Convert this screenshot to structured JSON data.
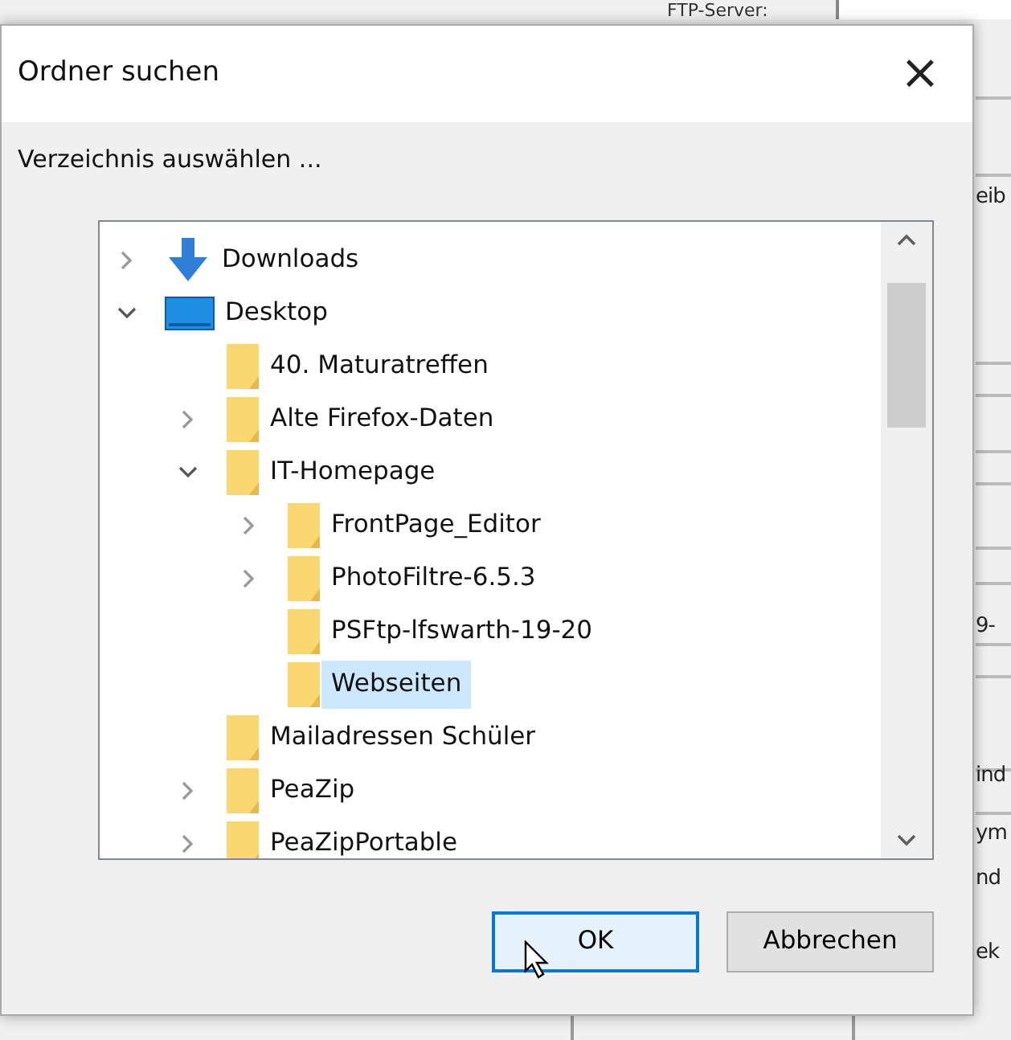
{
  "background_window": {
    "server_label": "FTP-Server:",
    "fragments": [
      {
        "text": "eib"
      },
      {
        "text": "9-"
      },
      {
        "text": "ind"
      },
      {
        "text": "ym"
      },
      {
        "text": "nd"
      },
      {
        "text": "ek"
      }
    ]
  },
  "dialog": {
    "title": "Ordner suchen",
    "close": "×",
    "prompt": "Verzeichnis auswählen ...",
    "tree": [
      {
        "label": "Downloads",
        "kind": "downloads",
        "expanded": false,
        "selected": false
      },
      {
        "label": "Desktop",
        "kind": "desktop",
        "expanded": true,
        "selected": false,
        "children": [
          {
            "label": "40. Maturatreffen",
            "kind": "folder",
            "selected": false
          },
          {
            "label": "Alte Firefox-Daten",
            "kind": "folder",
            "expanded": false,
            "selected": false
          },
          {
            "label": "IT-Homepage",
            "kind": "folder",
            "expanded": true,
            "selected": false,
            "children": [
              {
                "label": "FrontPage_Editor",
                "kind": "folder",
                "expanded": false,
                "selected": false
              },
              {
                "label": "PhotoFiltre-6.5.3",
                "kind": "folder",
                "expanded": false,
                "selected": false
              },
              {
                "label": "PSFtp-lfswarth-19-20",
                "kind": "folder",
                "selected": false
              },
              {
                "label": "Webseiten",
                "kind": "folder",
                "selected": true
              }
            ]
          },
          {
            "label": "Mailadressen Schüler",
            "kind": "folder",
            "selected": false
          },
          {
            "label": "PeaZip",
            "kind": "folder",
            "expanded": false,
            "selected": false
          },
          {
            "label": "PeaZipPortable",
            "kind": "folder",
            "expanded": false,
            "selected": false
          }
        ]
      }
    ],
    "buttons": [
      {
        "label": "OK",
        "default": true
      },
      {
        "label": "Abbrechen",
        "default": false
      }
    ]
  }
}
